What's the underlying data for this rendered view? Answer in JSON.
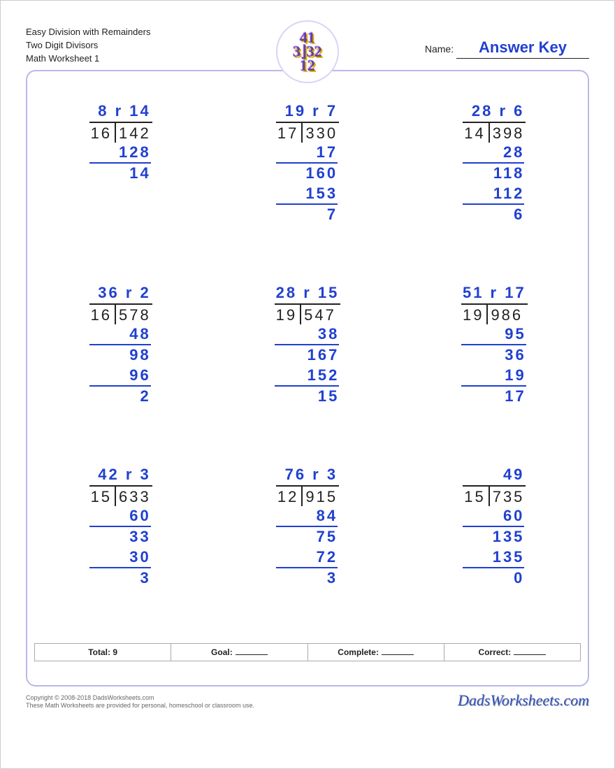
{
  "header": {
    "line1": "Easy Division with Remainders",
    "line2": "Two Digit Divisors",
    "line3": "Math Worksheet 1",
    "name_label": "Name:",
    "name_value": "Answer Key"
  },
  "badge": {
    "line1": "41",
    "line2": "3⌋32",
    "line3": "12"
  },
  "problems": [
    {
      "divisor": "16",
      "dividend": "142",
      "quotient": "8",
      "remainder": "14",
      "steps": [
        {
          "t": "min",
          "v": "128"
        },
        {
          "t": "res",
          "v": "14"
        }
      ]
    },
    {
      "divisor": "17",
      "dividend": "330",
      "quotient": "19",
      "remainder": "7",
      "steps": [
        {
          "t": "min",
          "v": "17"
        },
        {
          "t": "res",
          "v": "160"
        },
        {
          "t": "min",
          "v": "153"
        },
        {
          "t": "res",
          "v": "7"
        }
      ]
    },
    {
      "divisor": "14",
      "dividend": "398",
      "quotient": "28",
      "remainder": "6",
      "steps": [
        {
          "t": "min",
          "v": "28"
        },
        {
          "t": "res",
          "v": "118"
        },
        {
          "t": "min",
          "v": "112"
        },
        {
          "t": "res",
          "v": "6"
        }
      ]
    },
    {
      "divisor": "16",
      "dividend": "578",
      "quotient": "36",
      "remainder": "2",
      "steps": [
        {
          "t": "min",
          "v": "48"
        },
        {
          "t": "res",
          "v": "98"
        },
        {
          "t": "min",
          "v": "96"
        },
        {
          "t": "res",
          "v": "2"
        }
      ]
    },
    {
      "divisor": "19",
      "dividend": "547",
      "quotient": "28",
      "remainder": "15",
      "steps": [
        {
          "t": "min",
          "v": "38"
        },
        {
          "t": "res",
          "v": "167"
        },
        {
          "t": "min",
          "v": "152"
        },
        {
          "t": "res",
          "v": "15"
        }
      ]
    },
    {
      "divisor": "19",
      "dividend": "986",
      "quotient": "51",
      "remainder": "17",
      "steps": [
        {
          "t": "min",
          "v": "95"
        },
        {
          "t": "res",
          "v": "36"
        },
        {
          "t": "min",
          "v": "19"
        },
        {
          "t": "res",
          "v": "17"
        }
      ]
    },
    {
      "divisor": "15",
      "dividend": "633",
      "quotient": "42",
      "remainder": "3",
      "steps": [
        {
          "t": "min",
          "v": "60"
        },
        {
          "t": "res",
          "v": "33"
        },
        {
          "t": "min",
          "v": "30"
        },
        {
          "t": "res",
          "v": "3"
        }
      ]
    },
    {
      "divisor": "12",
      "dividend": "915",
      "quotient": "76",
      "remainder": "3",
      "steps": [
        {
          "t": "min",
          "v": "84"
        },
        {
          "t": "res",
          "v": "75"
        },
        {
          "t": "min",
          "v": "72"
        },
        {
          "t": "res",
          "v": "3"
        }
      ]
    },
    {
      "divisor": "15",
      "dividend": "735",
      "quotient": "49",
      "remainder": "",
      "steps": [
        {
          "t": "min",
          "v": "60"
        },
        {
          "t": "res",
          "v": "135"
        },
        {
          "t": "min",
          "v": "135"
        },
        {
          "t": "res",
          "v": "0"
        }
      ]
    }
  ],
  "footer": {
    "total_label": "Total:",
    "total_value": "9",
    "goal_label": "Goal:",
    "complete_label": "Complete:",
    "correct_label": "Correct:"
  },
  "copyright": {
    "line1": "Copyright © 2008-2018 DadsWorksheets.com",
    "line2": "These Math Worksheets are provided for personal, homeschool or classroom use.",
    "site": "DadsWorksheets.com"
  }
}
